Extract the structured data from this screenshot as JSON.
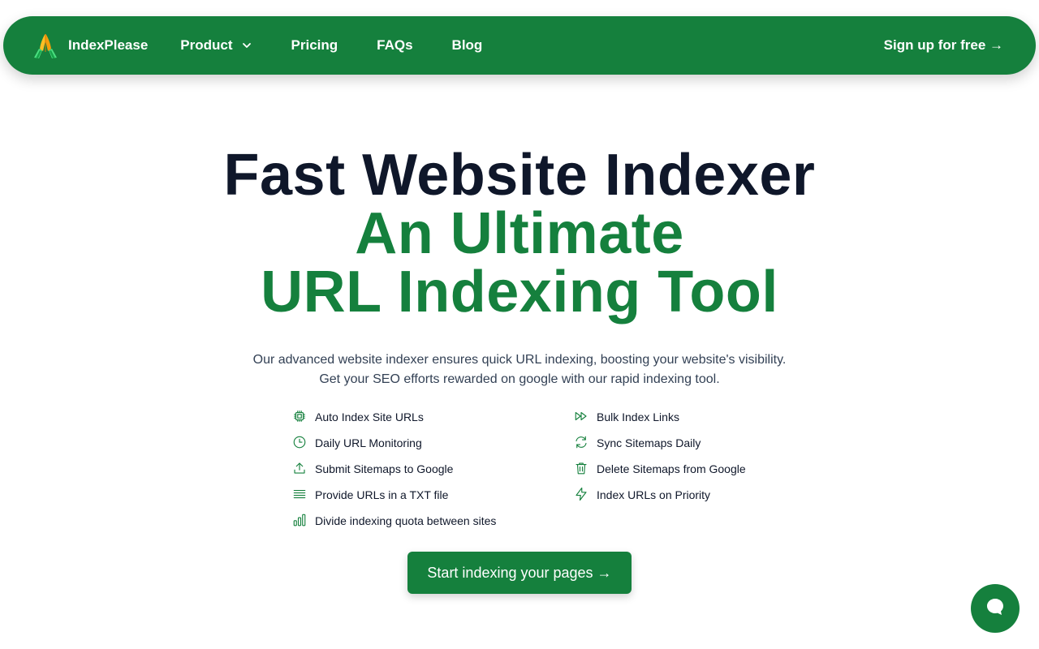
{
  "nav": {
    "brand_name": "IndexPlease",
    "brand_logo_icon": "praying-hands-icon",
    "links": [
      {
        "label": "Product",
        "has_dropdown": true
      },
      {
        "label": "Pricing"
      },
      {
        "label": "FAQs"
      },
      {
        "label": "Blog"
      }
    ],
    "signup_label": "Sign up for free →"
  },
  "hero": {
    "headline_line1": "Fast Website Indexer",
    "headline_line2": "An Ultimate",
    "headline_line3": "URL Indexing Tool",
    "subtitle_line1": "Our advanced website indexer ensures quick URL indexing, boosting your website's visibility.",
    "subtitle_line2": "Get your SEO efforts rewarded on google with our rapid indexing tool."
  },
  "features": [
    {
      "label": "Auto Index Site URLs",
      "icon": "cpu-chip-icon"
    },
    {
      "label": "Bulk Index Links",
      "icon": "fast-forward-icon"
    },
    {
      "label": "Daily URL Monitoring",
      "icon": "clock-icon"
    },
    {
      "label": "Sync Sitemaps Daily",
      "icon": "refresh-icon"
    },
    {
      "label": "Submit Sitemaps to Google",
      "icon": "upload-icon"
    },
    {
      "label": "Delete Sitemaps from Google",
      "icon": "trash-icon"
    },
    {
      "label": "Provide URLs in a TXT file",
      "icon": "list-lines-icon"
    },
    {
      "label": "Index URLs on Priority",
      "icon": "lightning-bolt-icon"
    },
    {
      "label": "Divide indexing quota between sites",
      "icon": "bar-chart-icon"
    }
  ],
  "cta_label": "Start indexing your pages →",
  "chat_widget_icon": "chat-bubble-icon",
  "colors": {
    "brand_green": "#15803d",
    "heading_dark": "#0f172a",
    "body_text": "#334155",
    "background": "#ffffff"
  }
}
